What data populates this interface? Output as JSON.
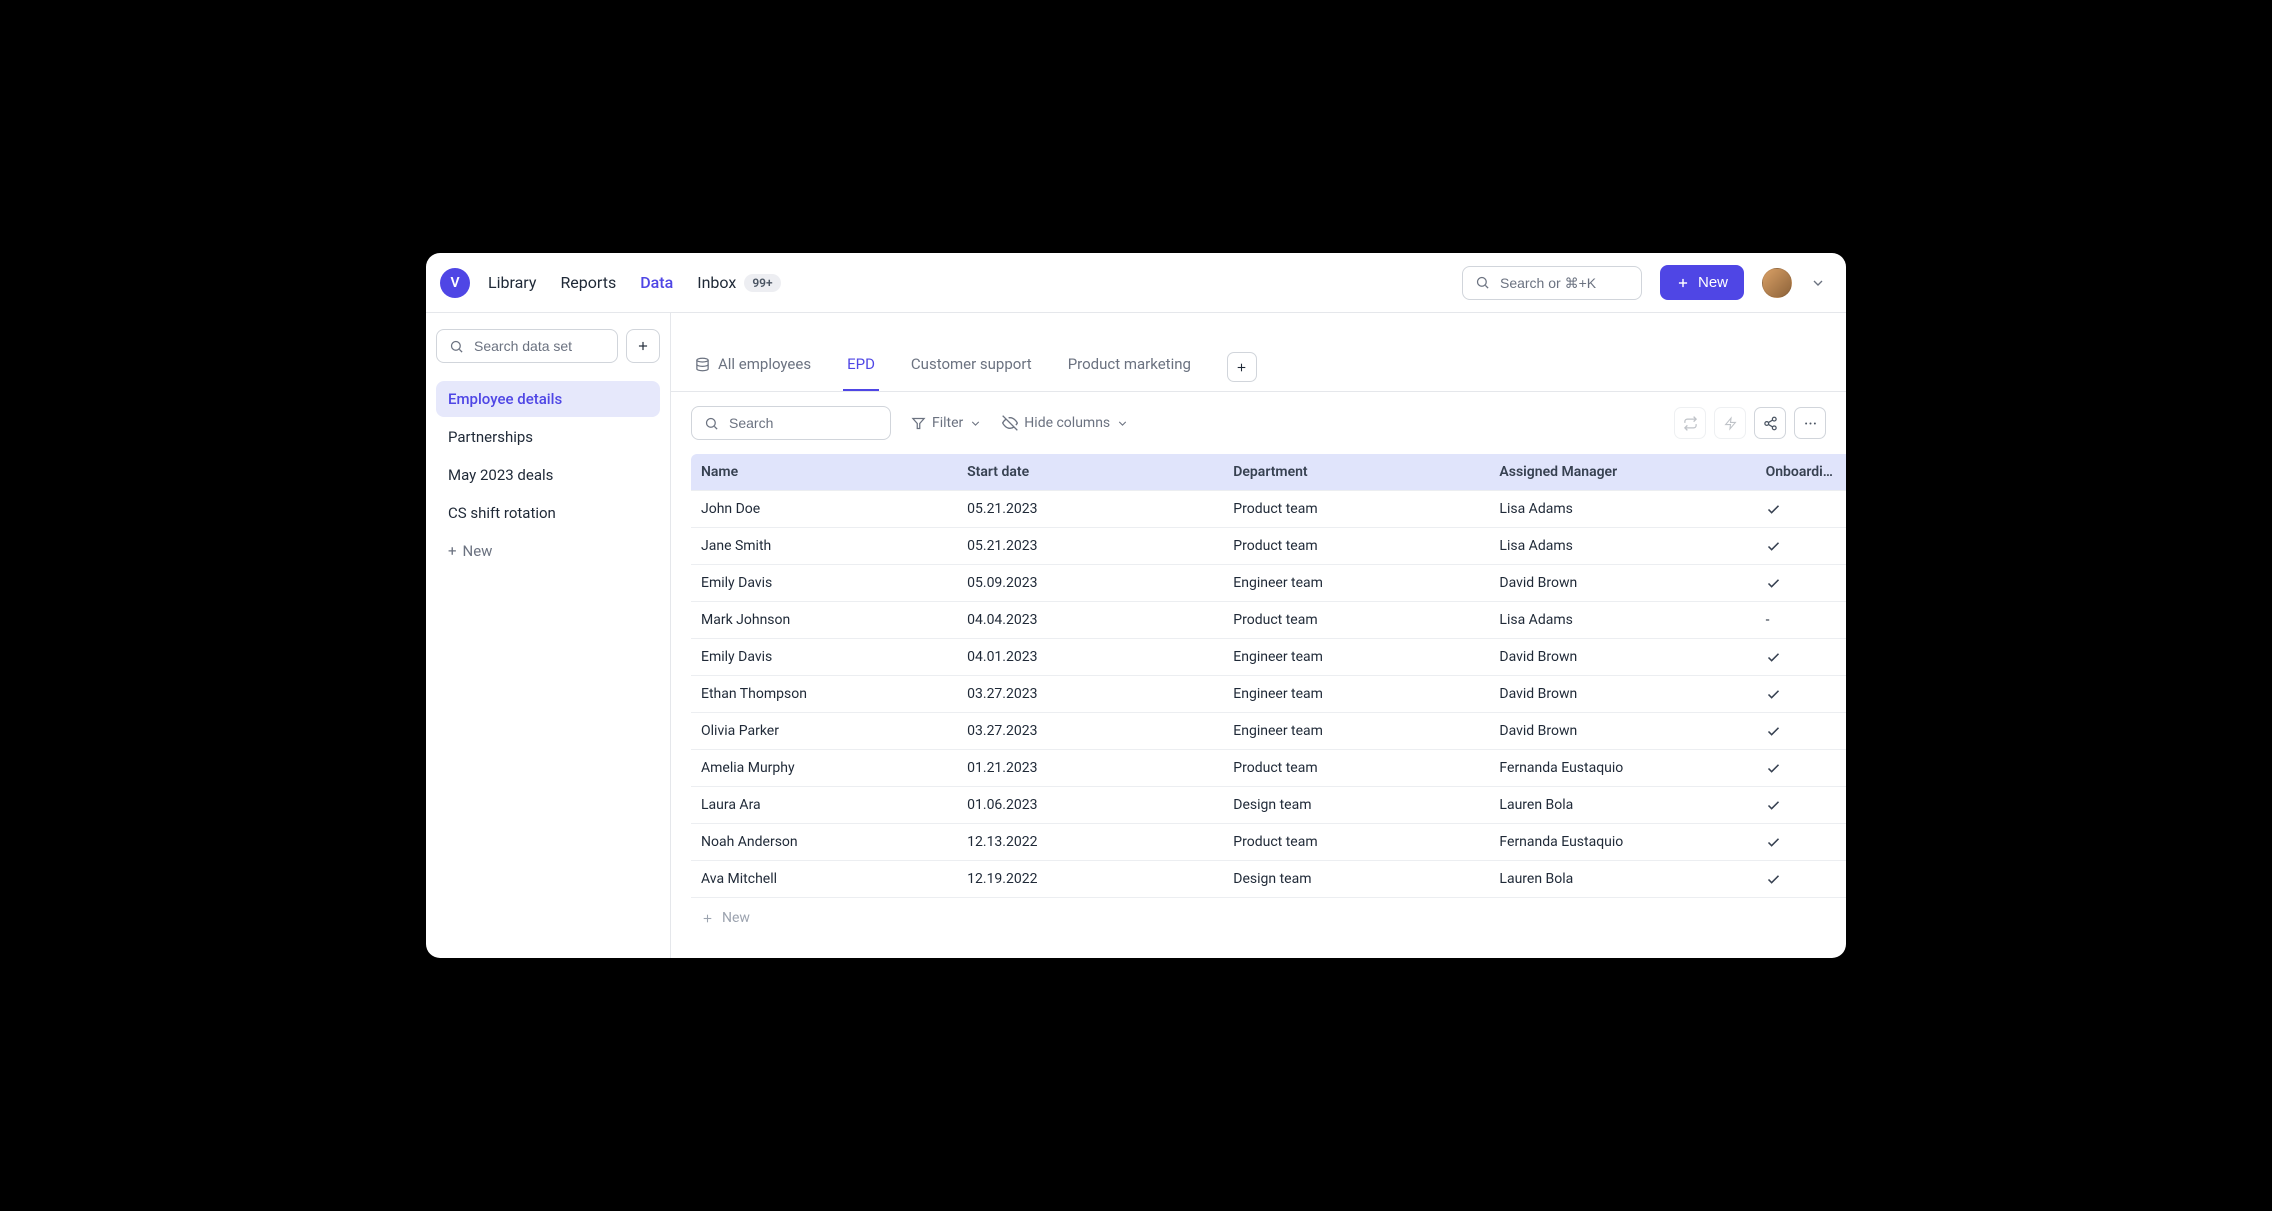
{
  "brand_letter": "V",
  "nav": {
    "items": [
      {
        "label": "Library",
        "active": false
      },
      {
        "label": "Reports",
        "active": false
      },
      {
        "label": "Data",
        "active": true
      },
      {
        "label": "Inbox",
        "active": false,
        "badge": "99+"
      }
    ]
  },
  "global_search": {
    "placeholder": "Search or ⌘+K"
  },
  "new_button": {
    "label": "New"
  },
  "sidebar": {
    "search_placeholder": "Search data set",
    "items": [
      {
        "label": "Employee details",
        "selected": true
      },
      {
        "label": "Partnerships",
        "selected": false
      },
      {
        "label": "May 2023 deals",
        "selected": false
      },
      {
        "label": "CS shift rotation",
        "selected": false
      }
    ],
    "add_label": "New"
  },
  "tabs": [
    {
      "label": "All employees",
      "icon": "database",
      "active": false
    },
    {
      "label": "EPD",
      "active": true
    },
    {
      "label": "Customer support",
      "active": false
    },
    {
      "label": "Product marketing",
      "active": false
    }
  ],
  "toolbar": {
    "search_placeholder": "Search",
    "filter_label": "Filter",
    "hide_columns_label": "Hide columns"
  },
  "table": {
    "columns": [
      "Name",
      "Start date",
      "Department",
      "Assigned Manager",
      "Onboarding"
    ],
    "rows": [
      {
        "name": "John Doe",
        "start": "05.21.2023",
        "dept": "Product team",
        "mgr": "Lisa Adams",
        "onb": "check"
      },
      {
        "name": "Jane Smith",
        "start": "05.21.2023",
        "dept": "Product team",
        "mgr": "Lisa Adams",
        "onb": "check"
      },
      {
        "name": "Emily Davis",
        "start": "05.09.2023",
        "dept": "Engineer team",
        "mgr": "David Brown",
        "onb": "check"
      },
      {
        "name": "Mark Johnson",
        "start": "04.04.2023",
        "dept": "Product team",
        "mgr": "Lisa Adams",
        "onb": "-"
      },
      {
        "name": "Emily Davis",
        "start": "04.01.2023",
        "dept": "Engineer team",
        "mgr": "David Brown",
        "onb": "check"
      },
      {
        "name": "Ethan Thompson",
        "start": "03.27.2023",
        "dept": "Engineer team",
        "mgr": "David Brown",
        "onb": "check"
      },
      {
        "name": "Olivia Parker",
        "start": "03.27.2023",
        "dept": "Engineer team",
        "mgr": "David Brown",
        "onb": "check"
      },
      {
        "name": "Amelia Murphy",
        "start": "01.21.2023",
        "dept": "Product team",
        "mgr": "Fernanda Eustaquio",
        "onb": "check"
      },
      {
        "name": "Laura Ara",
        "start": "01.06.2023",
        "dept": "Design team",
        "mgr": "Lauren Bola",
        "onb": "check"
      },
      {
        "name": "Noah Anderson",
        "start": "12.13.2022",
        "dept": "Product team",
        "mgr": "Fernanda Eustaquio",
        "onb": "check"
      },
      {
        "name": "Ava Mitchell",
        "start": "12.19.2022",
        "dept": "Design team",
        "mgr": "Lauren Bola",
        "onb": "check"
      }
    ],
    "add_row_label": "New"
  }
}
